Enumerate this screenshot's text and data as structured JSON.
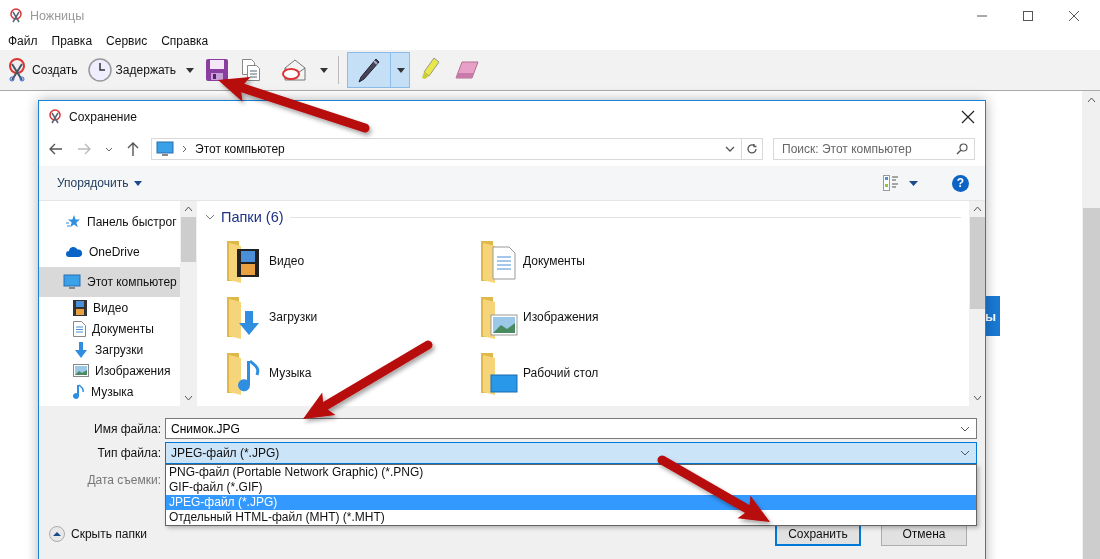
{
  "window": {
    "title": "Ножницы"
  },
  "menu": [
    "Файл",
    "Правка",
    "Сервис",
    "Справка"
  ],
  "toolbar": [
    {
      "kind": "new",
      "label": "Создать"
    },
    {
      "kind": "delay",
      "label": "Задержать"
    },
    {
      "kind": "save"
    },
    {
      "kind": "copy"
    },
    {
      "kind": "send"
    },
    {
      "kind": "pen",
      "selected": true
    },
    {
      "kind": "highlighter",
      "selected": false
    },
    {
      "kind": "eraser",
      "selected": false
    }
  ],
  "background_button": {
    "label": "ы"
  },
  "dialog": {
    "title": "Сохранение",
    "address": "Этот компьютер",
    "search": {
      "placeholder": "Поиск: Этот компьютер"
    },
    "organize": "Упорядочить",
    "help": "?",
    "nav_pane": [
      {
        "label": "Панель быстрог",
        "kind": "star",
        "selected": false
      },
      {
        "label": "OneDrive",
        "kind": "cloud",
        "selected": false
      },
      {
        "label": "Этот компьютер",
        "kind": "computer",
        "selected": true,
        "children": [
          {
            "label": "Видео",
            "kind": "video",
            "selected": false
          },
          {
            "label": "Документы",
            "kind": "documents",
            "selected": false
          },
          {
            "label": "Загрузки",
            "kind": "downloads",
            "selected": false
          },
          {
            "label": "Изображения",
            "kind": "pictures",
            "selected": false
          },
          {
            "label": "Музыка",
            "kind": "music",
            "selected": false
          }
        ]
      }
    ],
    "folders_header": "Папки (6)",
    "folders": [
      {
        "name": "Видео",
        "kind": "video"
      },
      {
        "name": "Документы",
        "kind": "documents"
      },
      {
        "name": "Загрузки",
        "kind": "downloads"
      },
      {
        "name": "Изображения",
        "kind": "pictures"
      },
      {
        "name": "Музыка",
        "kind": "music"
      },
      {
        "name": "Рабочий стол",
        "kind": "desktop"
      }
    ],
    "file_name": {
      "label": "Имя файла:",
      "value": "Снимок.JPG"
    },
    "file_type": {
      "label": "Тип файла:",
      "value": "JPEG-файл (*.JPG)",
      "expanded": true,
      "options": [
        {
          "label": "PNG-файл (Portable Network Graphic) (*.PNG)",
          "selected": false
        },
        {
          "label": "GIF-файл (*.GIF)",
          "selected": false
        },
        {
          "label": "JPEG-файл (*.JPG)",
          "selected": true
        },
        {
          "label": "Отдельный HTML-файл (MHT) (*.MHT)",
          "selected": false
        }
      ]
    },
    "date_label": "Дата съемки:",
    "hide_folders": "Скрыть папки",
    "buttons": [
      {
        "label": "Сохранить",
        "default": true
      },
      {
        "label": "Отмена",
        "default": false
      }
    ]
  }
}
